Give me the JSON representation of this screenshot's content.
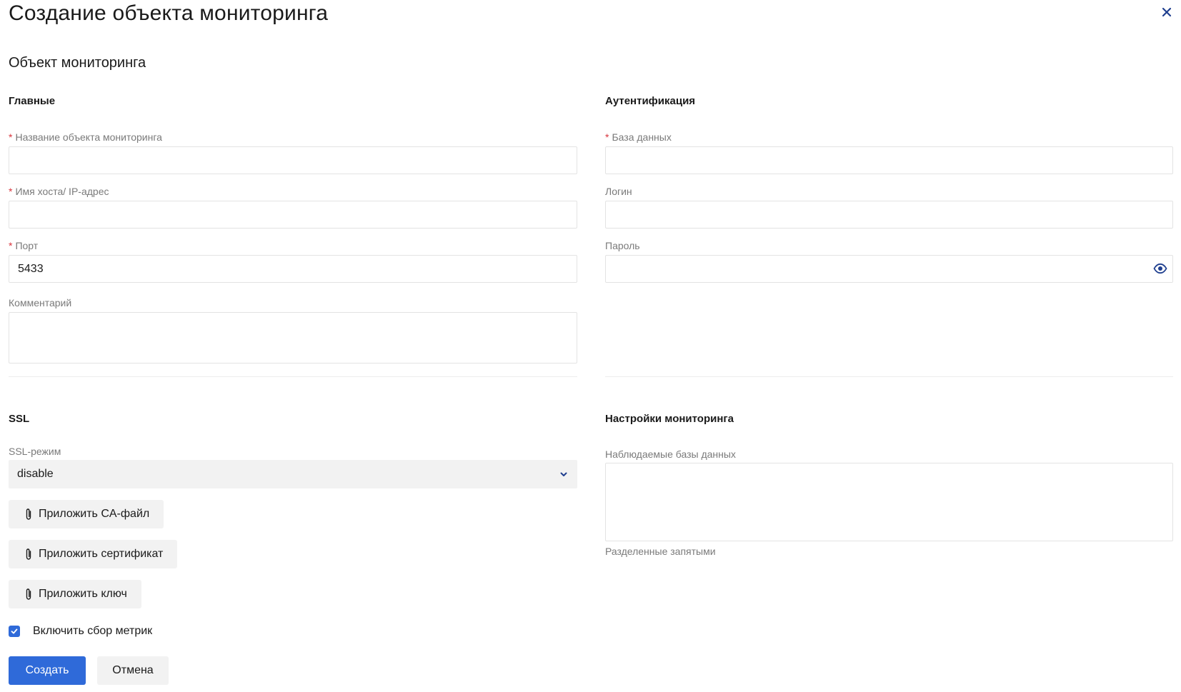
{
  "page": {
    "title": "Создание объекта мониторинга"
  },
  "section": {
    "title": "Объект мониторинга"
  },
  "main": {
    "title": "Главные",
    "name_label": "Название объекта мониторинга",
    "name_value": "",
    "host_label": "Имя хоста/ IP-адрес",
    "host_value": "",
    "port_label": "Порт",
    "port_value": "5433",
    "comment_label": "Комментарий",
    "comment_value": ""
  },
  "auth": {
    "title": "Аутентификация",
    "db_label": "База данных",
    "db_value": "",
    "login_label": "Логин",
    "login_value": "",
    "password_label": "Пароль",
    "password_value": ""
  },
  "ssl": {
    "title": "SSL",
    "mode_label": "SSL-режим",
    "mode_value": "disable",
    "attach_ca_label": "Приложить CA-файл",
    "attach_cert_label": "Приложить сертификат",
    "attach_key_label": "Приложить ключ"
  },
  "monitoring": {
    "title": "Настройки мониторинга",
    "dbs_label": "Наблюдаемые базы данных",
    "dbs_value": "",
    "dbs_hint": "Разделенные запятыми"
  },
  "metrics": {
    "label": "Включить сбор метрик",
    "checked": true
  },
  "actions": {
    "create_label": "Создать",
    "cancel_label": "Отмена"
  },
  "colors": {
    "accent": "#2f6ad9",
    "required": "#d9363e",
    "icon": "#1f3f8f"
  },
  "icons": {
    "close": "close-icon",
    "chevron": "chevron-down-icon",
    "eye": "eye-icon",
    "paperclip": "paperclip-icon",
    "check": "check-icon"
  }
}
